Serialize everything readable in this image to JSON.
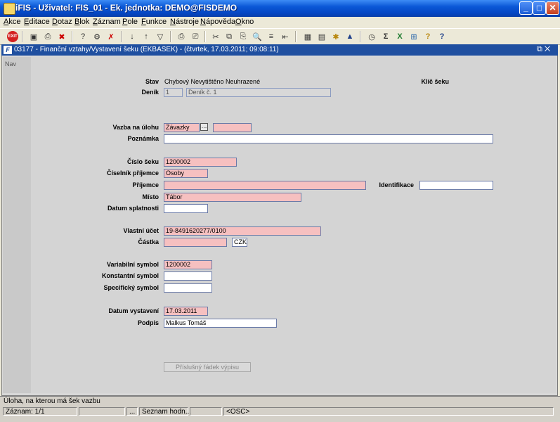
{
  "window": {
    "title": "iFIS - Uživatel: FIS_01 - Ek. jednotka: DEMO@FISDEMO",
    "buttons": {
      "minimize": "_",
      "maximize": "□",
      "close": "✕"
    }
  },
  "menu": [
    "Akce",
    "Editace",
    "Dotaz",
    "Blok",
    "Záznam",
    "Pole",
    "Funkce",
    "Nástroje",
    "Nápověda",
    "Okno"
  ],
  "toolbar": {
    "exit_label": "EXIT",
    "icons": [
      "save-icon",
      "print-icon",
      "delete-icon",
      "query-icon",
      "execute-icon",
      "cancel-icon",
      "sort-asc-icon",
      "sort-desc-icon",
      "filter-icon",
      "printer-icon",
      "print-setup-icon",
      "cut-icon",
      "copy-icon",
      "paste-icon",
      "find-icon",
      "insert-row-icon",
      "delete-row-icon",
      "calculator-icon",
      "document-icon",
      "settings-icon",
      "triangle-icon",
      "clock-icon",
      "sum-icon",
      "excel-icon",
      "export-icon",
      "help-icon",
      "whats-this-icon"
    ],
    "glyphs": [
      "▣",
      "⎙",
      "✖",
      "?",
      "⚙",
      "✗",
      "↓",
      "↑",
      "▽",
      "⎙",
      "⎚",
      "✂",
      "⧉",
      "⎘",
      "🔍",
      "≡",
      "⇤",
      "▦",
      "▤",
      "✱",
      "▲",
      "◷",
      "Σ",
      "X",
      "⊞",
      "?",
      "?"
    ]
  },
  "inner_window": {
    "title": "03177 - Finanční vztahy/Vystavení šeku (EKBASEK) - (čtvrtek, 17.03.2011; 09:08:11)",
    "icon_text": "F",
    "controls": "⧉ ✕"
  },
  "nav": {
    "label": "Nav"
  },
  "form": {
    "stav_label": "Stav",
    "stav_value": "Chybový Nevytištěno Neuhrazené",
    "klic_label": "Klíč šeku",
    "denik_label": "Deník",
    "denik_code": "1",
    "denik_name": "Deník č. 1",
    "vazba_label": "Vazba na úlohu",
    "vazba_value": "Závazky",
    "vazba_btn": "…",
    "vazba_extra": "",
    "poznamka_label": "Poznámka",
    "poznamka_value": "",
    "cislo_label": "Číslo šeku",
    "cislo_value": "1200002",
    "ciselnik_label": "Číselník příjemce",
    "ciselnik_value": "Osoby",
    "prijemce_label": "Příjemce",
    "prijemce_value": "",
    "identifikace_label": "Identifikace",
    "identifikace_value": "",
    "misto_label": "Místo",
    "misto_value": "Tábor",
    "splatnost_label": "Datum splatnosti",
    "splatnost_value": "",
    "ucet_label": "Vlastní účet",
    "ucet_value": "19-8491620277/0100",
    "castka_label": "Částka",
    "castka_value": "",
    "mena_value": "CZK",
    "varsym_label": "Variabilní symbol",
    "varsym_value": "1200002",
    "konstsym_label": "Konstantní symbol",
    "konstsym_value": "",
    "specsym_label": "Specifický symbol",
    "specsym_value": "",
    "vystaveni_label": "Datum vystavení",
    "vystaveni_value": "17.03.2011",
    "podpis_label": "Podpis",
    "podpis_value": "Malkus Tomáš",
    "radek_button": "Příslušný řádek výpisu"
  },
  "hint": "Úloha, na kterou má šek vazbu",
  "status": {
    "zaznam": "Záznam: 1/1",
    "blank1": "",
    "dots": "...",
    "seznam": "Seznam hodn...",
    "blank2": "",
    "osc": "<OSC>"
  }
}
